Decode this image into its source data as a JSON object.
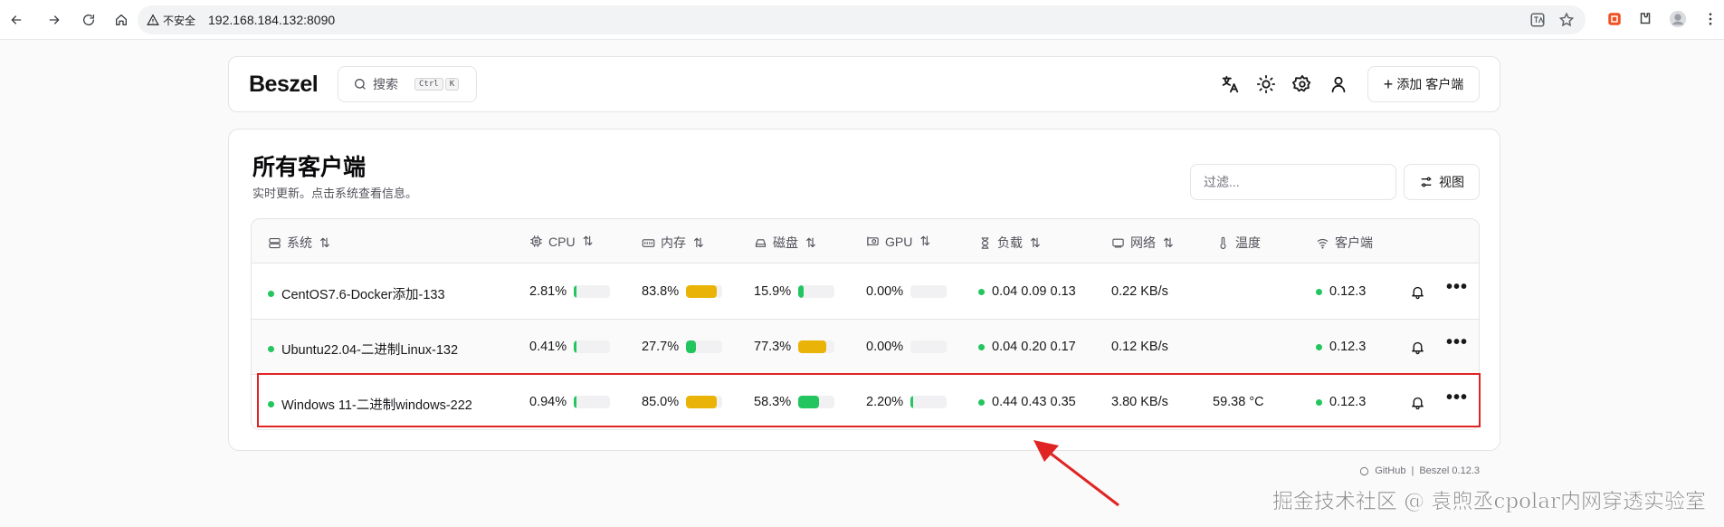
{
  "browser": {
    "insecure_label": "不安全",
    "url": "192.168.184.132:8090"
  },
  "header": {
    "logo": "Beszel",
    "search_label": "搜索",
    "kbd_ctrl": "Ctrl",
    "kbd_k": "K",
    "add_button": "添加 客户端"
  },
  "main": {
    "title": "所有客户端",
    "subtitle": "实时更新。点击系统查看信息。",
    "filter_placeholder": "过滤...",
    "view_button": "视图"
  },
  "columns": {
    "system": "系统",
    "cpu": "CPU",
    "memory": "内存",
    "disk": "磁盘",
    "gpu": "GPU",
    "load": "负载",
    "network": "网络",
    "temp": "温度",
    "agent": "客户端"
  },
  "rows": [
    {
      "name": "CentOS7.6-Docker添加-133",
      "cpu": "2.81%",
      "cpu_pct": 2.81,
      "mem": "83.8%",
      "mem_pct": 83.8,
      "disk": "15.9%",
      "disk_pct": 15.9,
      "gpu": "0.00%",
      "gpu_pct": 0,
      "load": "0.04 0.09 0.13",
      "net": "0.22 KB/s",
      "temp": "",
      "agent": "0.12.3"
    },
    {
      "name": "Ubuntu22.04-二进制Linux-132",
      "cpu": "0.41%",
      "cpu_pct": 0.41,
      "mem": "27.7%",
      "mem_pct": 27.7,
      "disk": "77.3%",
      "disk_pct": 77.3,
      "gpu": "0.00%",
      "gpu_pct": 0,
      "load": "0.04 0.20 0.17",
      "net": "0.12 KB/s",
      "temp": "",
      "agent": "0.12.3"
    },
    {
      "name": "Windows 11-二进制windows-222",
      "cpu": "0.94%",
      "cpu_pct": 0.94,
      "mem": "85.0%",
      "mem_pct": 85.0,
      "disk": "58.3%",
      "disk_pct": 58.3,
      "gpu": "2.20%",
      "gpu_pct": 2.2,
      "load": "0.44 0.43 0.35",
      "net": "3.80 KB/s",
      "temp": "59.38 °C",
      "agent": "0.12.3"
    }
  ],
  "colors": {
    "green": "#22c55e",
    "yellow": "#eab308",
    "highlight": "#e02424"
  },
  "footer": {
    "github": "GitHub",
    "separator": "|",
    "version": "Beszel 0.12.3"
  },
  "watermark": "掘金技术社区 @ 袁煦丞cpolar内网穿透实验室"
}
